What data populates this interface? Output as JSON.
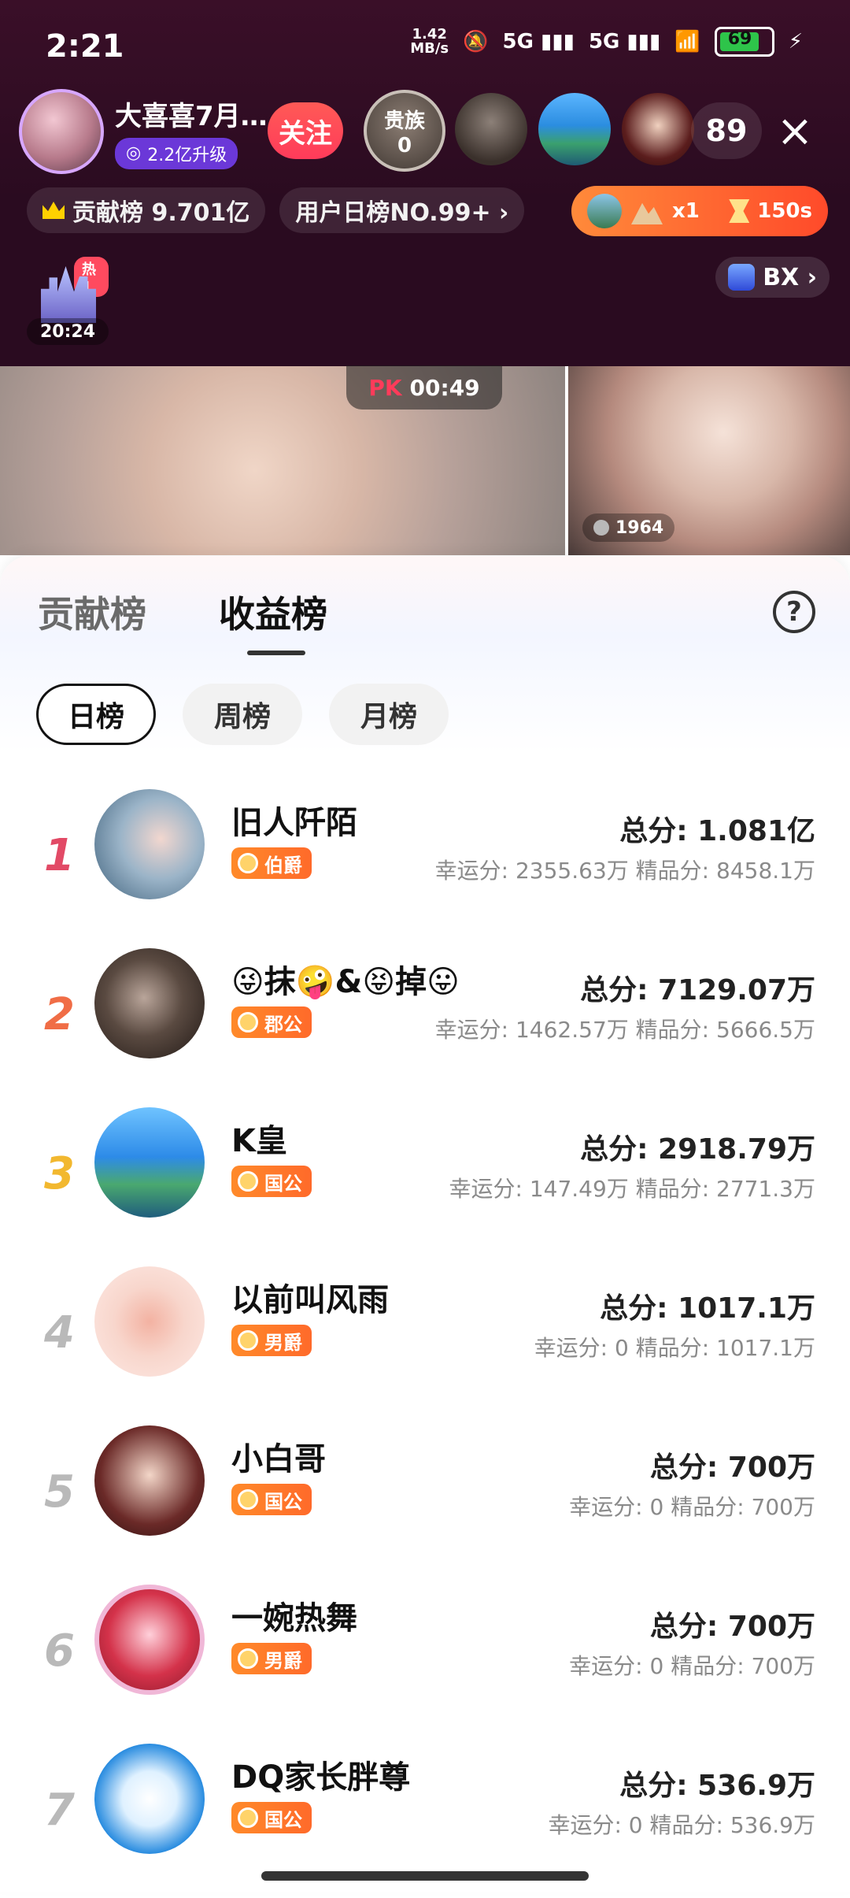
{
  "status_bar": {
    "time": "2:21",
    "network_speed": "1.42",
    "network_speed_unit": "MB/s",
    "signal1": "5G",
    "signal2": "5G",
    "battery_percent": "69"
  },
  "live_header": {
    "host_name": "大喜喜7月…",
    "host_badge": "2.2亿升级",
    "follow_label": "关注",
    "noble_label": "贵族",
    "noble_count": "0",
    "viewer_count": "89",
    "close_icon": "×",
    "contribution_rank_label": "贡献榜 9.701亿",
    "user_day_rank_label": "用户日榜NO.99+ ›",
    "gift_strip_text_multiplier": "x1",
    "gift_strip_timer": "150s",
    "hot_badge": "热1",
    "castle_timer": "20:24",
    "bx_label": "BX ›"
  },
  "pk": {
    "logo": "PK",
    "timer": "00:49",
    "right_score": "1964"
  },
  "sheet": {
    "tabs": [
      "贡献榜",
      "收益榜"
    ],
    "active_tab": "收益榜",
    "help": "?",
    "filters": [
      "日榜",
      "周榜",
      "月榜"
    ],
    "active_filter": "日榜",
    "rows": [
      {
        "rank": "1",
        "name": "旧人阡陌",
        "title": "伯爵",
        "total": "总分: 1.081亿",
        "detail": "幸运分: 2355.63万  精品分: 8458.1万"
      },
      {
        "rank": "2",
        "name": "😜抹🤪&😝掉😛",
        "title": "郡公",
        "total": "总分: 7129.07万",
        "detail": "幸运分: 1462.57万  精品分: 5666.5万"
      },
      {
        "rank": "3",
        "name": "K皇",
        "title": "国公",
        "total": "总分: 2918.79万",
        "detail": "幸运分: 147.49万  精品分: 2771.3万"
      },
      {
        "rank": "4",
        "name": "以前叫风雨",
        "title": "男爵",
        "total": "总分: 1017.1万",
        "detail": "幸运分: 0  精品分: 1017.1万"
      },
      {
        "rank": "5",
        "name": "小白哥",
        "title": "国公",
        "total": "总分: 700万",
        "detail": "幸运分: 0  精品分: 700万"
      },
      {
        "rank": "6",
        "name": "一婉热舞",
        "title": "男爵",
        "total": "总分: 700万",
        "detail": "幸运分: 0  精品分: 700万"
      },
      {
        "rank": "7",
        "name": "DQ家长胖尊",
        "title": "国公",
        "total": "总分: 536.9万",
        "detail": "幸运分: 0  精品分: 536.9万"
      }
    ]
  },
  "colors": {
    "accent_red": "#ff3b5a",
    "rank1": "#e24a66",
    "rank2": "#f06d46",
    "rank3": "#f2b82f",
    "rank_other": "#b9b9b9",
    "title_badge": "#ff6a2a"
  },
  "icons": {
    "close": "close-icon",
    "help": "help-icon",
    "crown": "crown-icon",
    "battery": "battery-icon",
    "wifi": "wifi-icon",
    "mute": "mute-icon",
    "bx": "bx-icon"
  }
}
